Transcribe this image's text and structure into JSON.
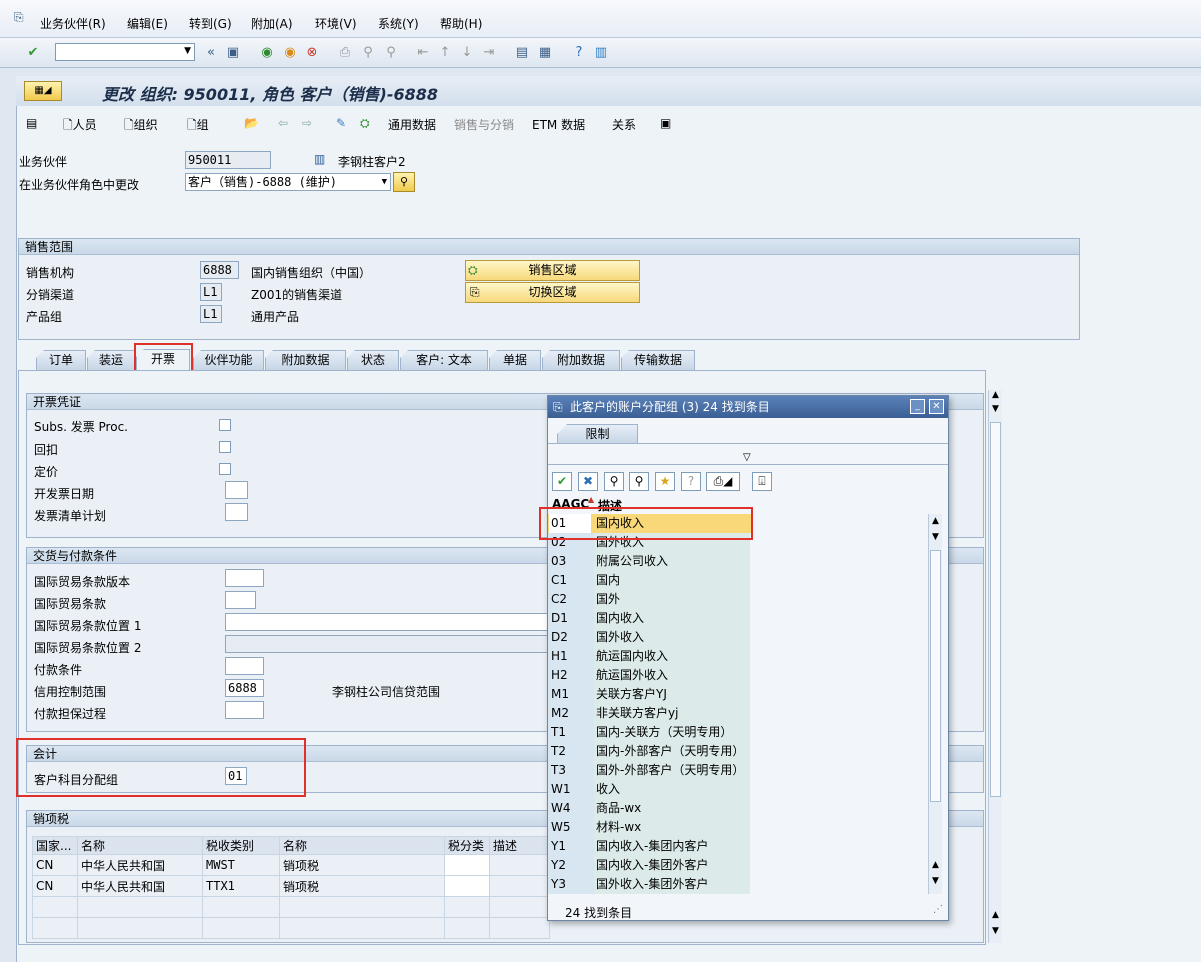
{
  "menu": [
    "业务伙伴(R)",
    "编辑(E)",
    "转到(G)",
    "附加(A)",
    "环境(V)",
    "系统(Y)",
    "帮助(H)"
  ],
  "title": "更改 组织: 950011, 角色 客户（销售)-6888",
  "app_toolbar": {
    "person": "人员",
    "org": "组织",
    "group": "组",
    "general_data": "通用数据",
    "sales_dist": "销售与分销",
    "etm_data": "ETM 数据",
    "relations": "关系"
  },
  "header": {
    "bp_label": "业务伙伴",
    "bp_value": "950011",
    "bp_name": "李钢柱客户2",
    "role_label": "在业务伙伴角色中更改",
    "role_value": "客户（销售)-6888 (维护)"
  },
  "sales_area": {
    "title": "销售范围",
    "org_label": "销售机构",
    "org_value": "6888",
    "org_desc": "国内销售组织（中国）",
    "channel_label": "分销渠道",
    "channel_value": "L1",
    "channel_desc": "Z001的销售渠道",
    "division_label": "产品组",
    "division_value": "L1",
    "division_desc": "通用产品",
    "btn_sales_area": "销售区域",
    "btn_switch_area": "切换区域"
  },
  "tabs": [
    "订单",
    "装运",
    "开票",
    "伙伴功能",
    "附加数据",
    "状态",
    "客户: 文本",
    "单据",
    "附加数据",
    "传输数据"
  ],
  "billing": {
    "title": "开票凭证",
    "subs": "Subs. 发票 Proc.",
    "rebate": "回扣",
    "pricing": "定价",
    "inv_dates": "开发票日期",
    "inv_list": "发票清单计划"
  },
  "delivery": {
    "title": "交货与付款条件",
    "inco_ver": "国际贸易条款版本",
    "inco": "国际贸易条款",
    "inco_loc1": "国际贸易条款位置 1",
    "inco_loc2": "国际贸易条款位置 2",
    "pay_terms": "付款条件",
    "credit_area": "信用控制范围",
    "credit_area_value": "6888",
    "credit_area_desc": "李钢柱公司信贷范围",
    "pay_guarantee": "付款担保过程"
  },
  "accounting": {
    "title": "会计",
    "acct_group_label": "客户科目分配组",
    "acct_group_value": "01"
  },
  "tax": {
    "title": "销项税",
    "headers": [
      "国家...",
      "名称",
      "税收类别",
      "名称",
      "税分类",
      "描述"
    ],
    "rows": [
      [
        "CN",
        "中华人民共和国",
        "MWST",
        "销项税"
      ],
      [
        "CN",
        "中华人民共和国",
        "TTX1",
        "销项税"
      ]
    ]
  },
  "popup": {
    "title": "此客户的账户分配组 (3)   24 找到条目",
    "tab": "限制",
    "col_code": "AAGC",
    "col_desc": "描述",
    "status": "24 找到条目",
    "items": [
      {
        "code": "01",
        "desc": "国内收入"
      },
      {
        "code": "02",
        "desc": "国外收入"
      },
      {
        "code": "03",
        "desc": "附属公司收入"
      },
      {
        "code": "C1",
        "desc": "国内"
      },
      {
        "code": "C2",
        "desc": "国外"
      },
      {
        "code": "D1",
        "desc": "国内收入"
      },
      {
        "code": "D2",
        "desc": "国外收入"
      },
      {
        "code": "H1",
        "desc": "航运国内收入"
      },
      {
        "code": "H2",
        "desc": "航运国外收入"
      },
      {
        "code": "M1",
        "desc": "关联方客户YJ"
      },
      {
        "code": "M2",
        "desc": "非关联方客户yj"
      },
      {
        "code": "T1",
        "desc": "国内-关联方（天明专用）"
      },
      {
        "code": "T2",
        "desc": "国内-外部客户（天明专用）"
      },
      {
        "code": "T3",
        "desc": "国外-外部客户（天明专用）"
      },
      {
        "code": "W1",
        "desc": "收入"
      },
      {
        "code": "W4",
        "desc": "商品-wx"
      },
      {
        "code": "W5",
        "desc": "材料-wx"
      },
      {
        "code": "Y1",
        "desc": "国内收入-集团内客户"
      },
      {
        "code": "Y2",
        "desc": "国内收入-集团外客户"
      },
      {
        "code": "Y3",
        "desc": "国外收入-集团外客户"
      }
    ]
  }
}
